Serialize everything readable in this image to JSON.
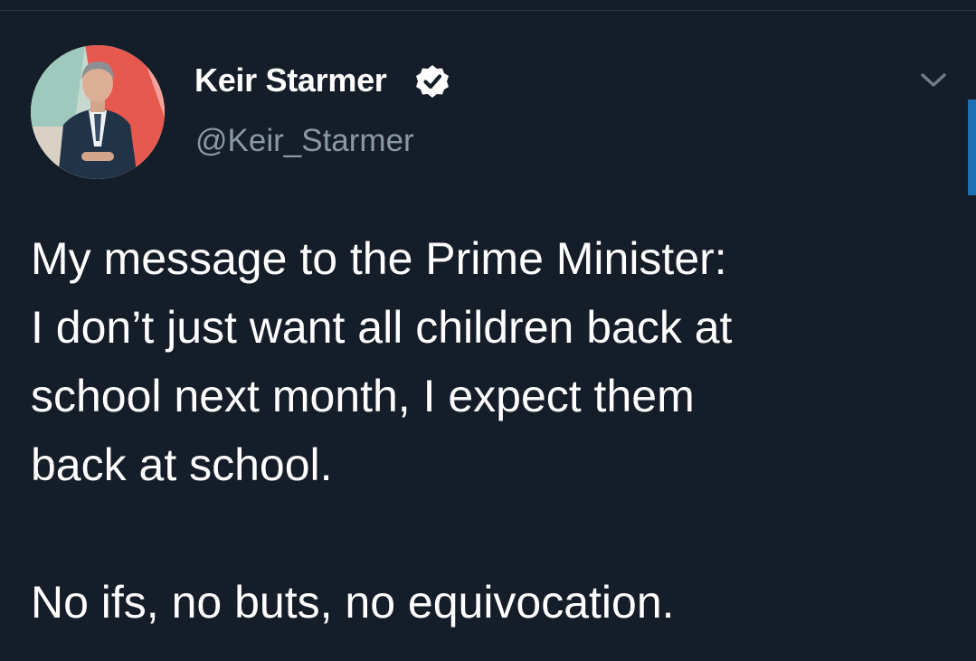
{
  "author": {
    "display_name": "Keir Starmer",
    "handle": "@Keir_Starmer",
    "verified_icon": "verified-badge-icon",
    "avatar_icon": "profile-photo"
  },
  "menu": {
    "icon": "chevron-down-icon"
  },
  "tweet": {
    "lines": [
      "My message to the Prime Minister:",
      "I don’t just want all children back at",
      "school next month, I expect them",
      "back at school.",
      "No ifs, no buts, no equivocation."
    ]
  },
  "colors": {
    "background": "#151d28",
    "text": "#ffffff",
    "secondary_text": "#8a98a6",
    "accent": "#1e6fb2"
  }
}
